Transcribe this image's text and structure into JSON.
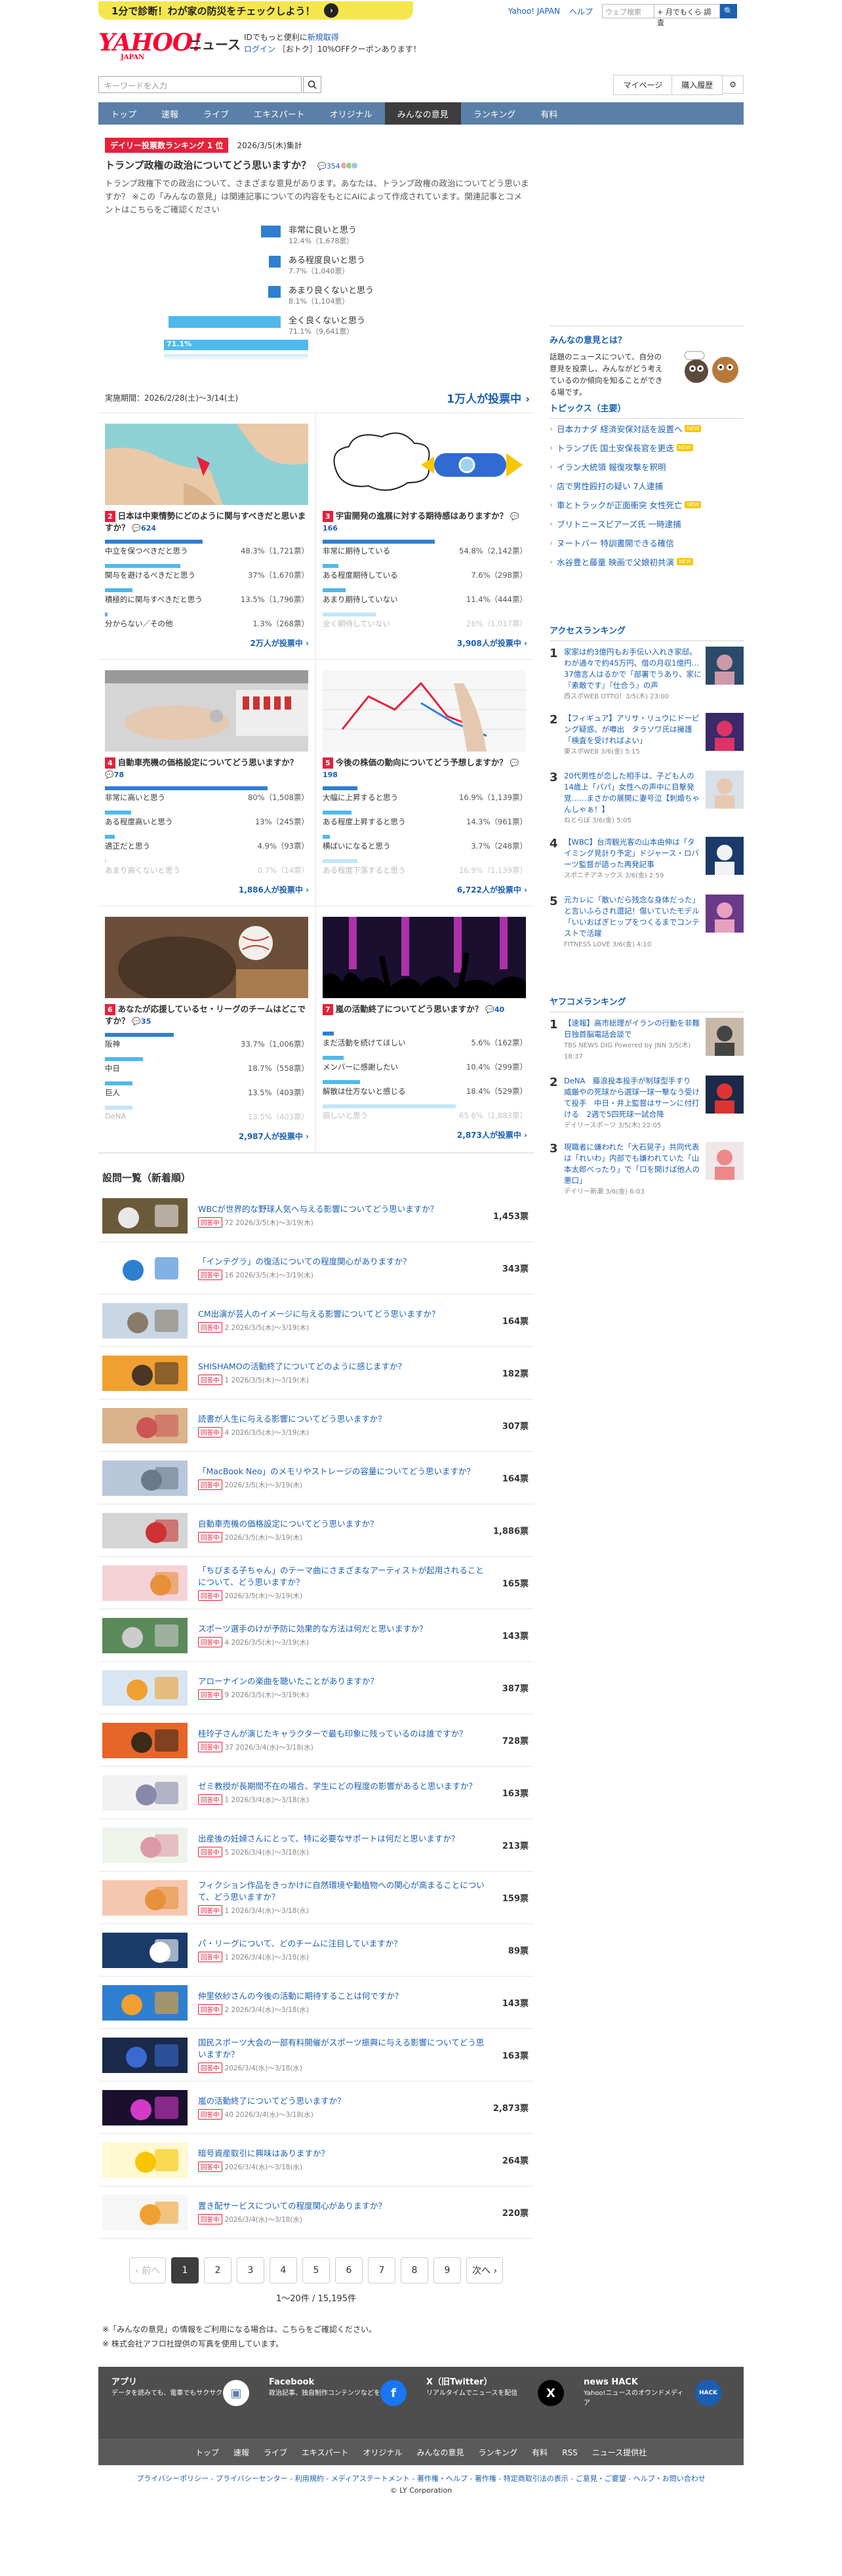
{
  "promo": {
    "text": "1分で診断！わが家の防災をチェックしよう！",
    "arrow": "›"
  },
  "toplinks": {
    "yahoo": "Yahoo! JAPAN",
    "help": "ヘルプ",
    "search_placeholder": "ウェブ検索",
    "search_scope": "+ 月でもくら 調査",
    "search_btn": "🔍"
  },
  "logo": {
    "main": "YAHOO!",
    "sub": "JAPAN",
    "news": "ニュース"
  },
  "idinfo": {
    "line1": "IDでもっと便利に",
    "line1b": "新規取得",
    "line2": "ログイン",
    "line3": "［おトク］10%OFFクーポンあります！"
  },
  "search": {
    "placeholder": "キーワードを入力",
    "mypage": "マイページ",
    "history": "購入履歴",
    "gear": "⚙"
  },
  "nav": [
    "トップ",
    "速報",
    "ライブ",
    "エキスパート",
    "オリジナル",
    "みんなの意見",
    "ランキング",
    "有料"
  ],
  "nav_active": 5,
  "featured": {
    "rank": "デイリー投票数ランキング 1 位",
    "date": "2026/3/5(木)集計",
    "title": "トランプ政権の政治についてどう思いますか？",
    "comments": "354",
    "desc": "トランプ政権下での政治について、さまざまな意見があります。あなたは、トランプ政権の政治についてどう思いますか？ ※この「みんなの意見」は関連記事についての内容をもとにAIによって作成されています。関連記事とコメントはこちらをご確認ください",
    "options": [
      {
        "label": "非常に良いと思う",
        "pct": "12.4%（1,678票）"
      },
      {
        "label": "ある程度良いと思う",
        "pct": "7.7%（1,040票）"
      },
      {
        "label": "あまり良くないと思う",
        "pct": "8.1%（1,104票）"
      },
      {
        "label": "全く良くないと思う",
        "pct": "71.1%（9,641票）"
      }
    ],
    "big": "71.1%",
    "period": "実施期間：2026/2/28(土)〜3/14(土)",
    "votes": "1万人が投票中 ›"
  },
  "cards": [
    {
      "n": "2",
      "title": "日本は中東情勢にどのように関与すべきだと思いますか？",
      "cm": "624",
      "opts": [
        [
          "中立を保つべきだと思う",
          "48.3%（1,721票）",
          48
        ],
        [
          "関与を避けるべきだと思う",
          "37%（1,670票）",
          37
        ],
        [
          "積極的に関与すべきだと思う",
          "13.5%（1,796票）",
          13.5
        ],
        [
          "分からない／その他",
          "1.3%（268票）",
          1.3
        ]
      ],
      "votes": "2万人が投票中 ›",
      "fadeLast": false
    },
    {
      "n": "3",
      "title": "宇宙開発の進展に対する期待感はありますか？",
      "cm": "166",
      "opts": [
        [
          "非常に期待している",
          "54.8%（2,142票）",
          55
        ],
        [
          "ある程度期待している",
          "7.6%（298票）",
          7.6
        ],
        [
          "あまり期待していない",
          "11.4%（444票）",
          11.4
        ],
        [
          "全く期待していない",
          "26%（1,017票）",
          26
        ]
      ],
      "votes": "3,908人が投票中 ›",
      "fadeLast": true
    },
    {
      "n": "4",
      "title": "自動車売機の価格設定についてどう思いますか？",
      "cm": "78",
      "opts": [
        [
          "非常に高いと思う",
          "80%（1,508票）",
          80
        ],
        [
          "ある程度高いと思う",
          "13%（245票）",
          13
        ],
        [
          "適正だと思う",
          "4.9%（93票）",
          4.9
        ],
        [
          "あまり高くないと思う",
          "0.7%（14票）",
          0.7
        ]
      ],
      "votes": "1,886人が投票中 ›",
      "fadeLast": true
    },
    {
      "n": "5",
      "title": "今後の株価の動向についてどう予想しますか？",
      "cm": "198",
      "opts": [
        [
          "大幅に上昇すると思う",
          "16.9%（1,139票）",
          17
        ],
        [
          "ある程度上昇すると思う",
          "14.3%（961票）",
          14.3
        ],
        [
          "横ばいになると思う",
          "3.7%（248票）",
          3.7
        ],
        [
          "ある程度下落すると思う",
          "16.9%（1,139票）",
          17
        ]
      ],
      "votes": "6,722人が投票中 ›",
      "fadeLast": true
    },
    {
      "n": "6",
      "title": "あなたが応援しているセ・リーグのチームはどこですか？",
      "cm": "35",
      "opts": [
        [
          "阪神",
          "33.7%（1,006票）",
          34
        ],
        [
          "中日",
          "18.7%（558票）",
          18.7
        ],
        [
          "巨人",
          "13.5%（403票）",
          13.5
        ],
        [
          "DeNA",
          "13.5%（403票）",
          13.5
        ]
      ],
      "votes": "2,987人が投票中 ›",
      "fadeLast": true
    },
    {
      "n": "7",
      "title": "嵐の活動終了についてどう思いますか？",
      "cm": "40",
      "opts": [
        [
          "まだ活動を続けてほしい",
          "5.6%（162票）",
          5.6
        ],
        [
          "メンバーに感謝したい",
          "10.4%（299票）",
          10.4
        ],
        [
          "解散は仕方ないと感じる",
          "18.4%（529票）",
          18.4
        ],
        [
          "寂しいと思う",
          "65.6%（1,883票）",
          65.6
        ]
      ],
      "votes": "2,873人が投票中 ›",
      "fadeLast": true
    }
  ],
  "list_heading": "設問一覧（新着順）",
  "list": [
    {
      "q": "WBCが世界的な野球人気へ与える影響についてどう思いますか？",
      "m": "72 2026/3/5(木)〜3/19(木)",
      "v": "1,453票"
    },
    {
      "q": "「インテグラ」の復活についての程度関心がありますか？",
      "m": "16 2026/3/5(木)〜3/19(木)",
      "v": "343票"
    },
    {
      "q": "CM出演が芸人のイメージに与える影響についてどう思いますか？",
      "m": "2 2026/3/5(木)〜3/19(木)",
      "v": "164票"
    },
    {
      "q": "SHISHAMOの活動終了についてどのように感じますか？",
      "m": "1 2026/3/5(木)〜3/19(木)",
      "v": "182票"
    },
    {
      "q": "読書が人生に与える影響についてどう思いますか？",
      "m": "4 2026/3/5(木)〜3/19(木)",
      "v": "307票"
    },
    {
      "q": "「MacBook Neo」のメモリやストレージの容量についてどう思いますか？",
      "m": "2026/3/5(木)〜3/19(木)",
      "v": "164票"
    },
    {
      "q": "自動車売機の価格設定についてどう思いますか？",
      "m": "2026/3/5(木)〜3/19(木)",
      "v": "1,886票"
    },
    {
      "q": "「ちびまる子ちゃん」のテーマ曲にさまざまなアーティストが起用されることについて、どう思いますか？",
      "m": "2026/3/5(木)〜3/19(木)",
      "v": "165票"
    },
    {
      "q": "スポーツ選手のけが予防に効果的な方法は何だと思いますか？",
      "m": "4 2026/3/5(木)〜3/19(木)",
      "v": "143票"
    },
    {
      "q": "アローナインの楽曲を聴いたことがありますか？",
      "m": "9 2026/3/5(木)〜3/19(木)",
      "v": "387票"
    },
    {
      "q": "桂玲子さんが演じたキャラクターで最も印象に残っているのは誰ですか？",
      "m": "37 2026/3/4(水)〜3/18(水)",
      "v": "728票"
    },
    {
      "q": "ゼミ教授が長期間不在の場合、学生にどの程度の影響があると思いますか？",
      "m": "1 2026/3/4(水)〜3/18(水)",
      "v": "163票"
    },
    {
      "q": "出産後の妊婦さんにとって、特に必要なサポートは何だと思いますか？",
      "m": "5 2026/3/4(水)〜3/18(水)",
      "v": "213票"
    },
    {
      "q": "フィクション作品をきっかけに自然環境や動植物への関心が高まることについて、どう思いますか？",
      "m": "1 2026/3/4(水)〜3/18(水)",
      "v": "159票"
    },
    {
      "q": "パ・リーグについて、どのチームに注目していますか？",
      "m": "1 2026/3/4(水)〜3/18(水)",
      "v": "89票"
    },
    {
      "q": "仲里依紗さんの今後の活動に期待することは何ですか？",
      "m": "2 2026/3/4(水)〜3/18(水)",
      "v": "143票"
    },
    {
      "q": "国民スポーツ大会の一部有料開催がスポーツ振興に与える影響についてどう思いますか？",
      "m": "2026/3/4(水)〜3/18(水)",
      "v": "163票"
    },
    {
      "q": "嵐の活動終了についてどう思いますか？",
      "m": "40 2026/3/4(水)〜3/18(水)",
      "v": "2,873票"
    },
    {
      "q": "暗号資産取引に興味はありますか？",
      "m": "2026/3/4(水)〜3/18(水)",
      "v": "264票"
    },
    {
      "q": "置き配サービスについての程度関心がありますか？",
      "m": "2026/3/4(水)〜3/18(水)",
      "v": "220票"
    }
  ],
  "tag": "回答中",
  "pager": {
    "prev": "‹ 前へ",
    "pages": [
      "1",
      "2",
      "3",
      "4",
      "5",
      "6",
      "7",
      "8",
      "9"
    ],
    "next": "次へ ›",
    "count": "1〜20件 / 15,195件"
  },
  "notes": [
    "※「みんなの意見」の情報をご利用になる場合は、こちらをご確認ください。",
    "※ 株式会社アフロ社提供の写真を使用しています。"
  ],
  "about": {
    "title": "みんなの意見とは？",
    "text": "話題のニュースについて、自分の意見を投票し、みんながどう考えているのか傾向を知ることができる場です。"
  },
  "topics": {
    "title": "トピックス（主要）",
    "items": [
      "日本カナダ 経済安保対話を設置へ",
      "トランプ氏 国土安保長官を更迭",
      "イラン大統領 報復攻撃を釈明",
      "店で男性殴打の疑い 7人逮捕",
      "車とトラックが正面衝突 女性死亡",
      "ブリトニースピアーズ氏 一時逮捕",
      "ヌートバー 特訓書開できる確信",
      "水谷豊と藤童 映画で父娘初共演"
    ]
  },
  "access": {
    "title": "アクセスランキング",
    "items": [
      {
        "t": "家家は約3億円もお手伝い入れき家邸。わが通々で約45万円、借の月収1億円…37億言人はるかで「部署でうあり、家に『素敵です』『仕合う』の声",
        "s": "西スポWEB OTTO！3/5(木) 23:00"
      },
      {
        "t": "【フィギュア】アリサ・リュウにドーピング疑惑、が噂出　タラソワ氏は擁護「検査を受ければよい」",
        "s": "東スポWEB 3/6(金) 5:15"
      },
      {
        "t": "20代男性が恋した相手は、子ども人の14歳上「パパ」女性への声中に目撃発覚……まさかの展開に妻号泣【刺婚ちゃんしゃぁ！】",
        "s": "ねとらぼ 3/6(金) 5:05"
      },
      {
        "t": "【WBC】台湾観光客の山本由伸は「タイミング見計り予定」ドジャース・ロバーツ監督が語った再発記事",
        "s": "スポニチアネックス 3/6(金) 2:59"
      },
      {
        "t": "元カレに「散いだら残念な身体だった」と言いふらされ還記！傷いていたモデル「いいおばぎヒップをつくるまでコンテストで活躍",
        "s": "FITNESS LOVE 3/6(金) 4:10"
      }
    ]
  },
  "yafuko": {
    "title": "ヤフコメランキング",
    "items": [
      {
        "t": "【速報】高市総理がイランの行動を非難　日独首脳電話会談で",
        "s": "TBS NEWS DIG Powered by JNN 3/5(木) 18:37"
      },
      {
        "t": "DeNA　藤浪投本投手が制球型手すり　威厳やの死球から選球一球一撃なう受けて投手　中日・井上監督はサーンに付打ける　2週で5四死球一試合降",
        "s": "デイリースポーツ 3/5(木) 22:05"
      },
      {
        "t": "現職者に嫌われた「大石晃子」共同代表は「れいわ」内部でも嫌われていた「山本太郎べったり」で「口を開けば他人の悪口」",
        "s": "デイリー新潮 3/6(金) 6:03"
      }
    ]
  },
  "footer": {
    "app_title": "アプリ",
    "app_text": "データを読みても、電車でもサクサク",
    "fb_title": "Facebook",
    "fb_text": "政治記事、独自制作コンテンツなどを投稿",
    "x_title": "X（旧Twitter）",
    "x_text": "リアルタイムでニュースを配信",
    "hack_title": "news HACK",
    "hack_text": "Yahoo!ニュースのオウンドメディア",
    "nav": [
      "トップ",
      "速報",
      "ライブ",
      "エキスパート",
      "オリジナル",
      "みんなの意見",
      "ランキング",
      "有料",
      "RSS",
      "ニュース提供社"
    ],
    "legal": "プライバシーポリシー - プライバシーセンター - 利用規約 - メディアステートメント - 著作権・ヘルプ - 著作権 - 特定商取引法の表示 - ご意見・ご要望 - ヘルプ・お問い合わせ",
    "copy": "© LY Corporation"
  },
  "colors": {
    "accent": "#e8203a",
    "link": "#1a5fb4",
    "bar": "#2f7fd1",
    "light_bar": "#4fb9ec",
    "nav": "#5b7fa8"
  }
}
